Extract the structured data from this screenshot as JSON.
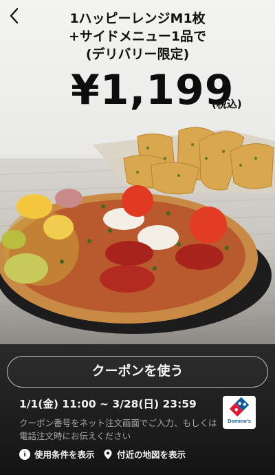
{
  "nav": {
    "back_icon": "‹"
  },
  "offer": {
    "title_lines": [
      "1ハッピーレンジM1枚",
      "+サイドメニュー1品で",
      "(デリバリー限定)"
    ],
    "price": "¥1,199",
    "tax_note": "(税込)"
  },
  "coupon": {
    "use_button_label": "クーポンを使う",
    "period": "1/1(金) 11:00 ~ 3/28(日) 23:59",
    "note": "クーポン番号をネット注文画面でご入力、もしくは電話注文時にお伝えください",
    "brand_logo_text": "Domino's"
  },
  "links": {
    "terms_label": "使用条件を表示",
    "map_label": "付近の地図を表示"
  },
  "colors": {
    "panel_bg": "#1a1a1a",
    "button_border": "#b8b8b8",
    "brand_blue": "#0b5c9b",
    "brand_red": "#e31837"
  }
}
